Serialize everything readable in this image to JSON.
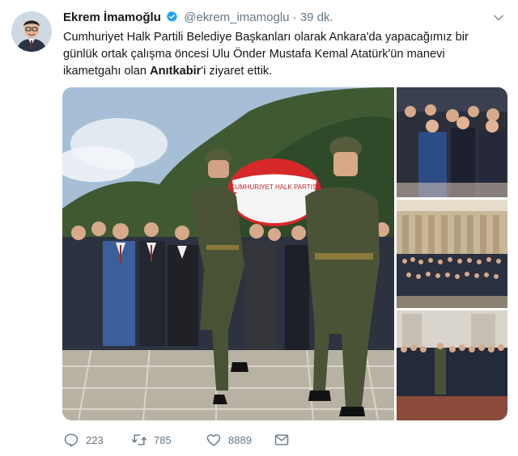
{
  "tweet": {
    "author_name": "Ekrem İmamoğlu",
    "handle": "@ekrem_imamoglu",
    "separator": "·",
    "time": "39 dk.",
    "text_part1": "Cumhuriyet Halk Partili Belediye Başkanları olarak Ankara'da yapacağımız bir günlük ortak çalışma öncesi Ulu Önder Mustafa Kemal Atatürk'ün manevi ikametgahı olan ",
    "text_bold": "Anıtkabir",
    "text_part2": "'i ziyaret ettik.",
    "wreath_text": "CUMHURIYET HALK PARTISI"
  },
  "stats": {
    "replies": "223",
    "retweets": "785",
    "likes": "8889"
  },
  "icons": {
    "verified": "verified-badge-icon",
    "caret": "chevron-down-icon",
    "reply": "reply-icon",
    "retweet": "retweet-icon",
    "like": "heart-icon",
    "dm": "envelope-icon"
  },
  "colors": {
    "text": "#14171a",
    "muted": "#657786",
    "verified": "#1da1f2",
    "uniform": "#4a5236"
  }
}
